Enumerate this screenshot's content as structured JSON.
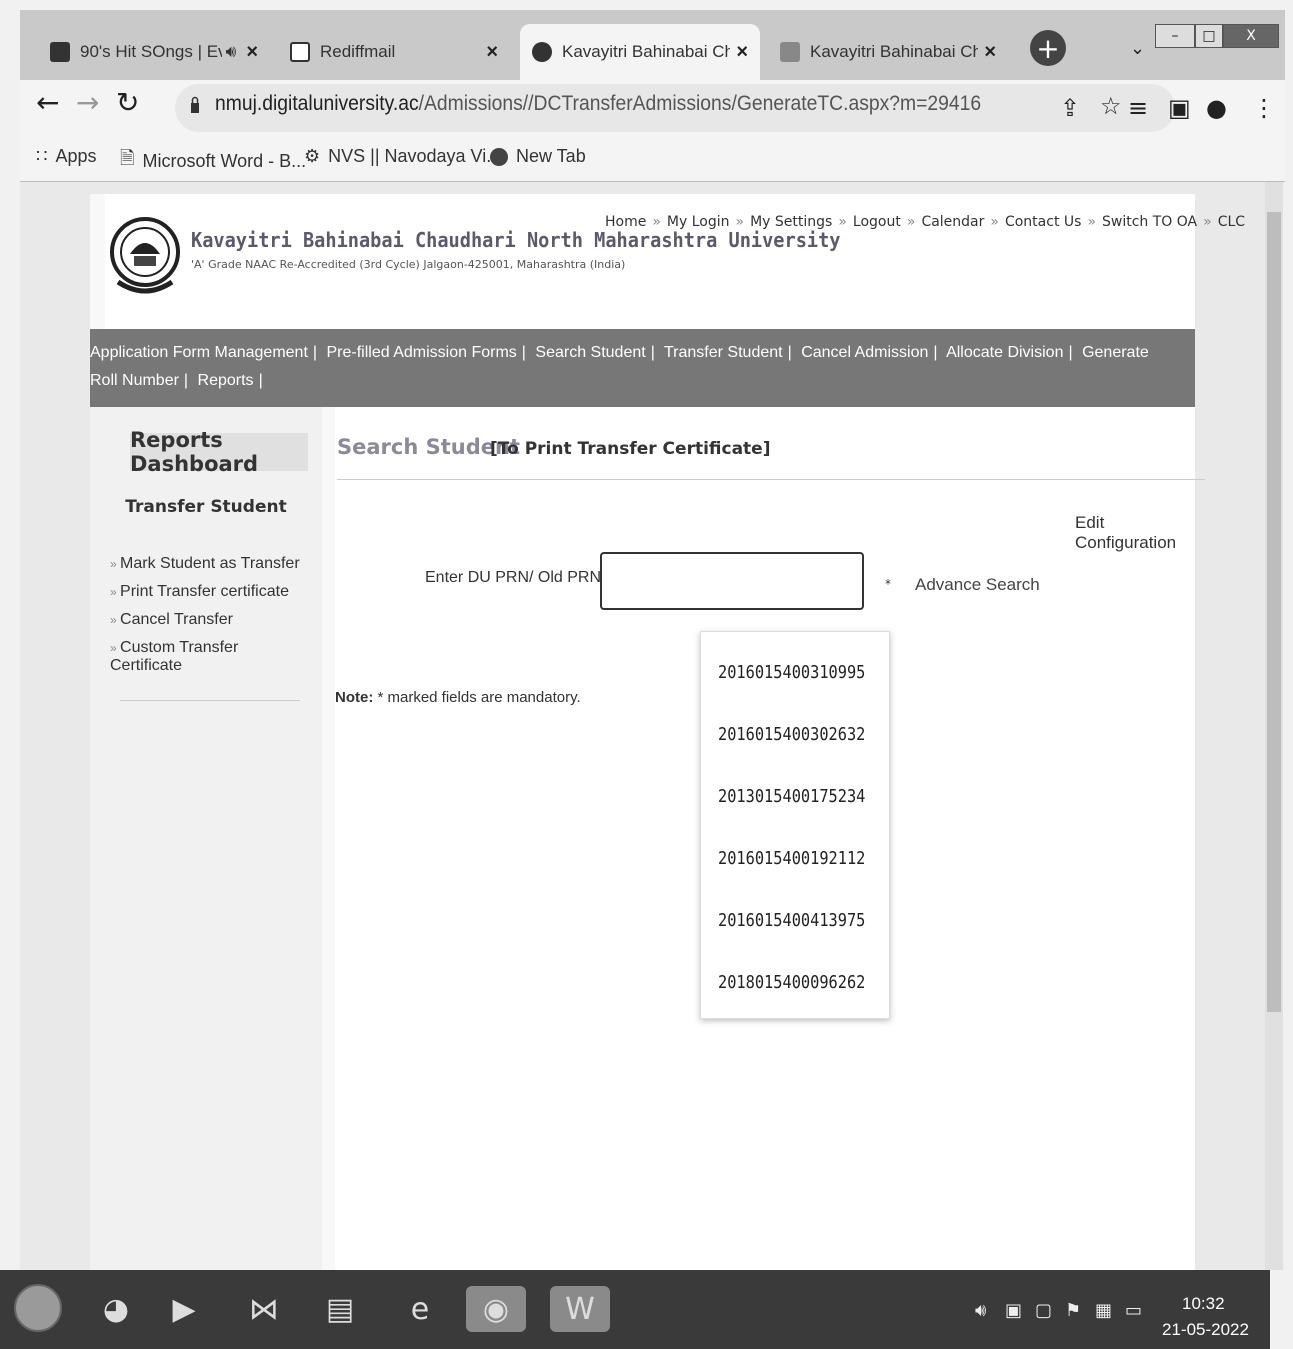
{
  "browser": {
    "tabs": [
      {
        "title": "90's Hit SOngs | Eve"
      },
      {
        "title": "Rediffmail"
      },
      {
        "title": "Kavayitri Bahinabai Cha"
      },
      {
        "title": "Kavayitri Bahinabai Cha"
      }
    ],
    "url_host": "nmuj.digitaluniversity.ac",
    "url_path": "/Admissions//DCTransferAdmissions/GenerateTC.aspx?m=29416",
    "bookmarks": [
      "Apps",
      "Microsoft Word - B...",
      "NVS || Navodaya Vi...",
      "New Tab"
    ]
  },
  "site": {
    "university_name": "Kavayitri Bahinabai Chaudhari North Maharashtra University",
    "university_sub": "'A' Grade NAAC Re-Accredited (3rd Cycle) Jalgaon-425001, Maharashtra (India)",
    "top_links": [
      "Home",
      "My Login",
      "My Settings",
      "Logout",
      "Calendar",
      "Contact Us",
      "Switch TO OA",
      "CLC"
    ],
    "menu": [
      "Application Form Management",
      "Pre-filled Admission Forms",
      "Search Student",
      "Transfer Student",
      "Cancel Admission",
      "Allocate Division",
      "Generate Roll Number",
      "Reports"
    ]
  },
  "sidebar": {
    "title": "Reports Dashboard",
    "subtitle": "Transfer Student",
    "items": [
      "Mark Student as Transfer",
      "Print Transfer certificate",
      "Cancel Transfer",
      "Custom Transfer Certificate"
    ]
  },
  "main": {
    "title": "Search Student",
    "subtitle": "[To Print Transfer Certificate]",
    "edit_config": "Edit Configuration",
    "prn_label": "Enter DU PRN/ Old PRN :",
    "prn_value": "",
    "required_mark": "*",
    "advance_search": "Advance Search",
    "note_label": "Note:",
    "note_text": " * marked fields are mandatory.",
    "suggestions": [
      "2016015400310995",
      "2016015400302632",
      "2013015400175234",
      "2016015400192112",
      "2016015400413975",
      "2018015400096262"
    ]
  },
  "taskbar": {
    "time": "10:32",
    "date": "21-05-2022"
  }
}
